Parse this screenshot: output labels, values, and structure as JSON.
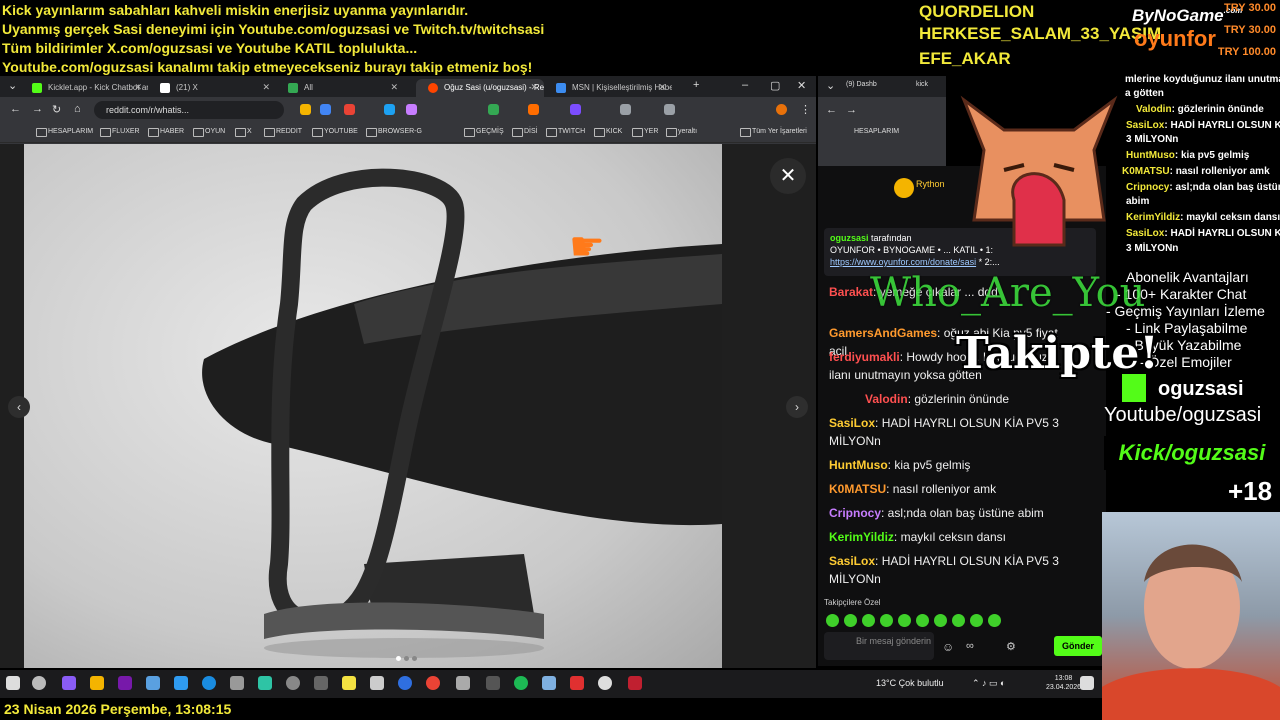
{
  "ticker": [
    "Kick yayınlarım sabahları kahveli miskin enerjisiz uyanma yayınlarıdır.",
    "Uyanmış gerçek Sasi deneyimi için Youtube.com/oguzsasi ve Twitch.tv/twitchsasi",
    "Tüm bildirimler X.com/oguzsasi ve Youtube KATIL toplulukta...",
    "Youtube.com/oguzsasi kanalımı takip etmeyecekseniz burayı takip etmeniz boş!"
  ],
  "viewer_names": [
    "QUORDELION",
    "HERKESE_SALAM_33_YAŞIM",
    "EFE_AKAR"
  ],
  "brand": {
    "bynogame": "ByNoGame",
    "bynogame_sub": ".com",
    "oyunfor": "oyunfor"
  },
  "donations": [
    "TRY 30.00",
    "TRY 30.00",
    "TRY 100.00"
  ],
  "browser": {
    "tabs": [
      {
        "title": "Kicklet.app - Kick Chatbot and",
        "color": "#53fc18"
      },
      {
        "title": "(21) X",
        "color": "#ffffff"
      },
      {
        "title": "All",
        "color": "#34a853"
      },
      {
        "title": "Oğuz Sasi (u/oguzsasi) - Reddit",
        "color": "#ff4500"
      },
      {
        "title": "MSN | Kişiselleştirilmiş Haber",
        "color": "#3c8cf0"
      }
    ],
    "url": "reddit.com/r/whatis...",
    "bookmarks": [
      "HESAPLARIM",
      "FLUXER",
      "HABER",
      "OYUN",
      "X",
      "REDDIT",
      "YOUTUBE",
      "BROWSER-G",
      "GEÇMİŞ",
      "DİSİ",
      "TWITCH",
      "KICK",
      "YER",
      "yeraltı",
      "Tüm Yer İşaretleri"
    ],
    "close_icon": "✕",
    "prev_icon": "‹",
    "next_icon": "›"
  },
  "browser2": {
    "tabs": [
      "(9) Dashb",
      "kick"
    ],
    "bookmark": "HESAPLARIM"
  },
  "chat": {
    "top_user": "Rython",
    "pinned_user": "oguzsasi",
    "pinned_by": "tarafından",
    "pinned_text": "OYUNFOR • BYNOGAME • ... KATIL • 1:",
    "pinned_link": "https://www.oyunfor.com/donate/sasi",
    "pinned_tail": "* 2:...",
    "messages": [
      {
        "user": "Barakat",
        "color": "#ff5050",
        "text": ": yemeğe çıkalar ... ddd"
      },
      {
        "user": "GamersAndGames",
        "color": "#ff9a2e",
        "text": ": oğuz abi Kia pv5 fiyat acil"
      },
      {
        "user": "ferdiyumakli",
        "color": "#ff5050",
        "text": ": Howdy hoo ... koyduğunuz ilanı unutmayın yoksa götten"
      },
      {
        "user": "Valodin",
        "color": "#ff5050",
        "text": ": gözlerinin önünde"
      },
      {
        "user": "SasiLox",
        "color": "#ffcc33",
        "text": ": HADİ HAYRLI OLSUN KİA PV5 3 MİLYONn"
      },
      {
        "user": "HuntMuso",
        "color": "#ffcc33",
        "text": ": kia pv5 gelmiş"
      },
      {
        "user": "K0MATSU",
        "color": "#ff9a2e",
        "text": ": nasıl rolleniyor amk"
      },
      {
        "user": "Cripnocy",
        "color": "#c77dff",
        "text": ": asl;nda olan baş üstüne abim"
      },
      {
        "user": "KerimYildiz",
        "color": "#53fc18",
        "text": ": maykıl ceksın dansı"
      },
      {
        "user": "SasiLox",
        "color": "#ffcc33",
        "text": ": HADİ HAYRLI OLSUN KİA PV5 3 MİLYONn"
      }
    ],
    "followers_only_label": "Takipçilere Özel",
    "input_placeholder": "Bir mesaj gönderin",
    "send_label": "Gönder"
  },
  "overlay_chat": [
    {
      "user": "",
      "text": "mlerine koyduğunuz ilanı unutmayın"
    },
    {
      "user": "",
      "text": "a götten"
    },
    {
      "user": "Valodin",
      "text": ": gözlerinin önünde"
    },
    {
      "user": "SasiLox",
      "text": ": HADİ HAYRLI OLSUN KİA PV5"
    },
    {
      "user": "",
      "text": "3 MİLYONn"
    },
    {
      "user": "HuntMuso",
      "text": ": kia pv5 gelmiş"
    },
    {
      "user": "K0MATSU",
      "text": ": nasıl rolleniyor amk"
    },
    {
      "user": "Cripnocy",
      "text": ": asl;nda olan baş üstüne"
    },
    {
      "user": "",
      "text": "abim"
    },
    {
      "user": "KerimYildiz",
      "text": ": maykıl ceksın dansı"
    },
    {
      "user": "SasiLox",
      "text": ": HADİ HAYRLI OLSUN KİA PV5"
    },
    {
      "user": "",
      "text": "3 MİLYONn"
    }
  ],
  "perks": [
    "Abonelik Avantajları",
    "- 100+ Karakter Chat",
    "- Geçmiş Yayınları İzleme",
    "- Link Paylaşabilme",
    "- Büyük Yazabilme",
    "- Özel Emojiler"
  ],
  "overlay": {
    "who_are_you": "Who_Are_You",
    "takipte": "Takipte!"
  },
  "social": {
    "kick_handle": "oguzsasi",
    "youtube": "Youtube/oguzsasi",
    "kick_badge": "Kick/oguzsasi",
    "age": "+18"
  },
  "taskbar": {
    "weather": "13°C  Çok bulutlu",
    "time": "13:08",
    "date": "23.04.2026"
  },
  "datebar": "23 Nisan 2026 Perşembe, 13:08:15",
  "colors": {
    "ticker": "#f2e93a",
    "kick_green": "#53fc18",
    "oyunfor": "#ff7a1a"
  }
}
